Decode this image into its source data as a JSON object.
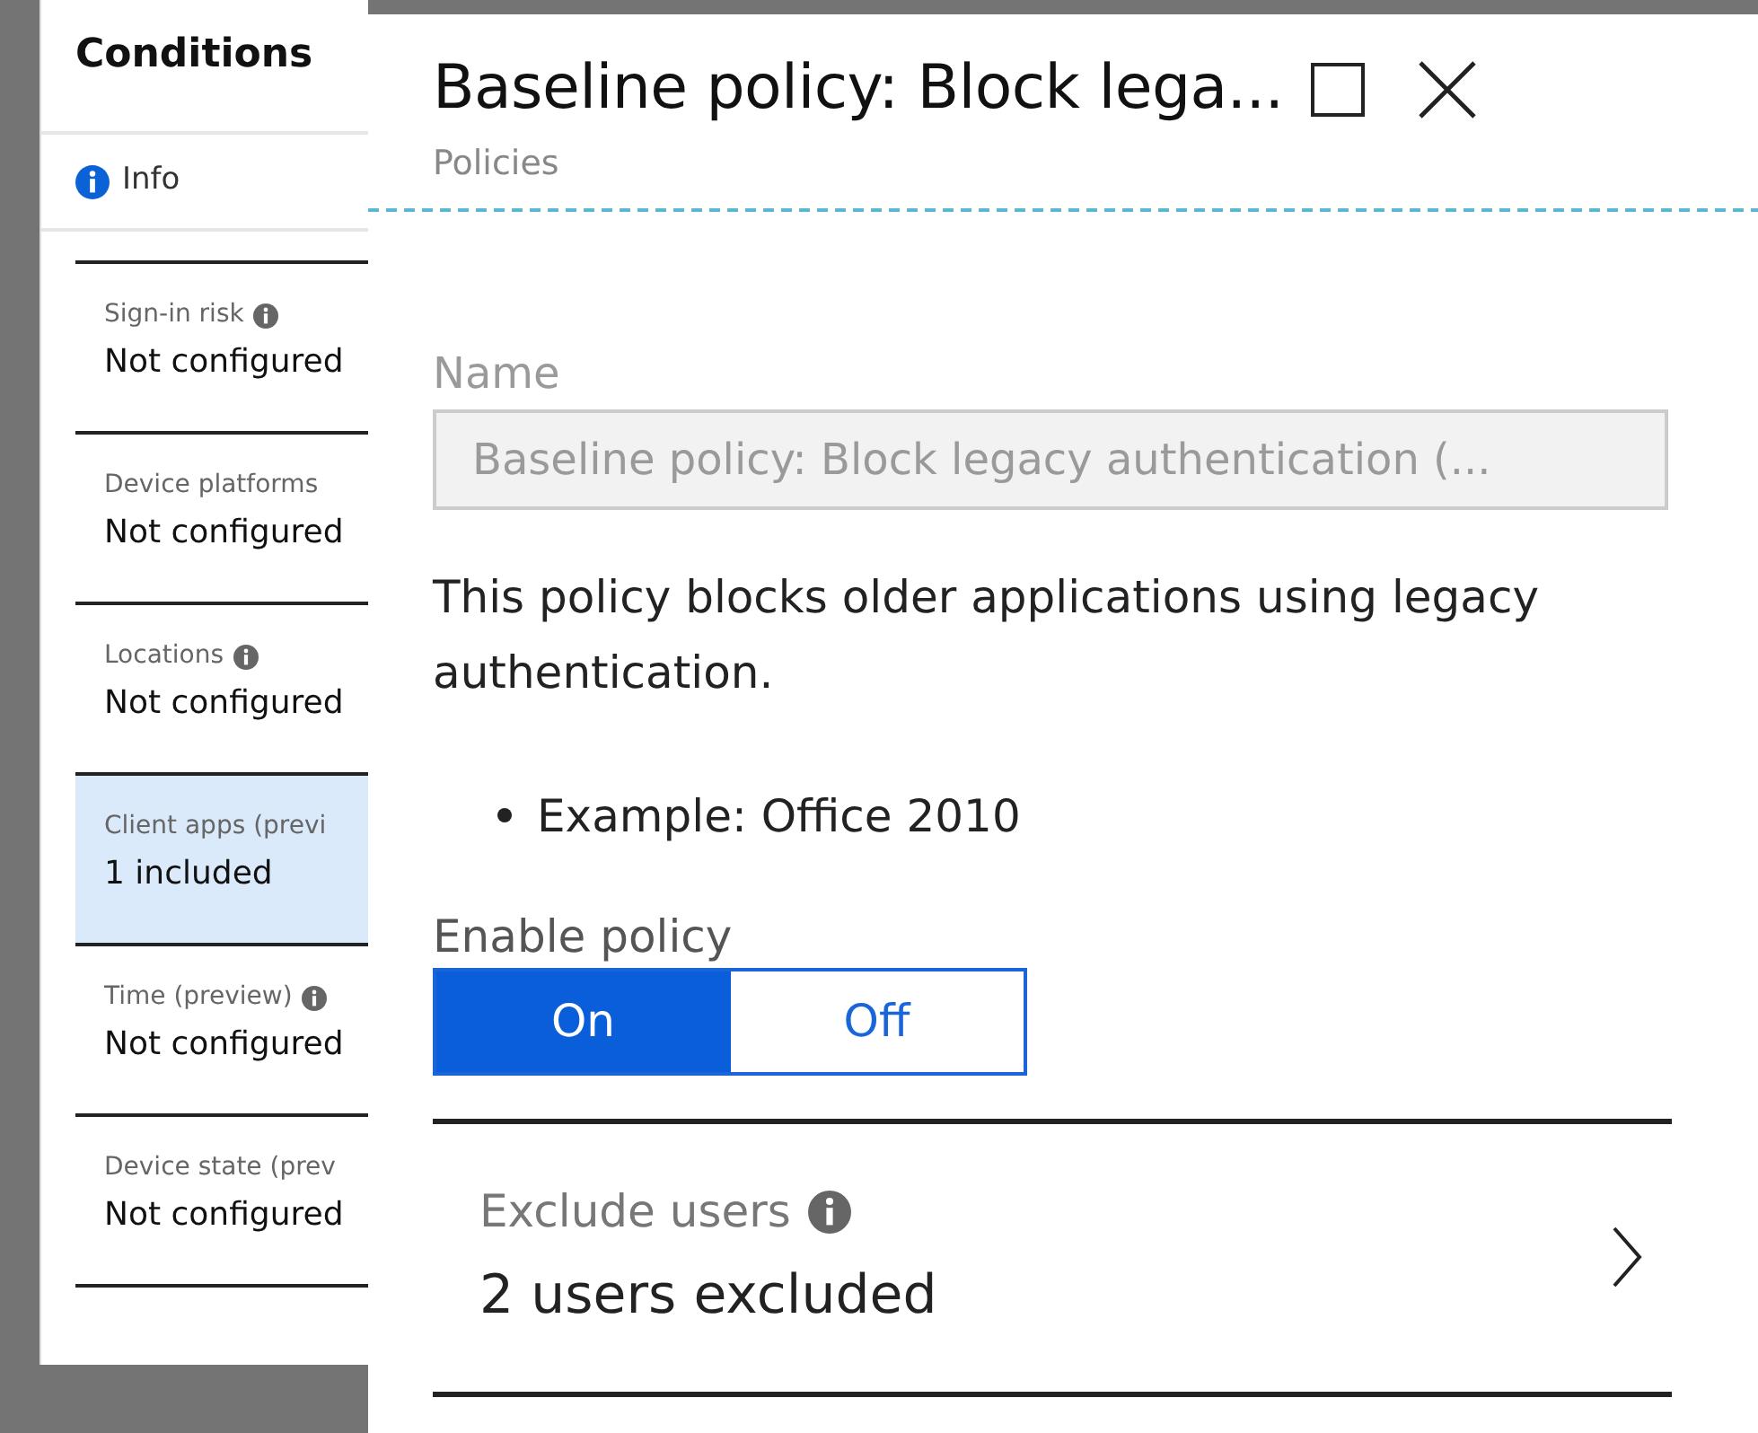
{
  "conditions_panel": {
    "title": "Conditions",
    "info_link": "Info",
    "items": [
      {
        "label": "Sign-in risk",
        "info": true,
        "value": "Not configured",
        "selected": false
      },
      {
        "label": "Device platforms",
        "info": false,
        "value": "Not configured",
        "selected": false
      },
      {
        "label": "Locations",
        "info": true,
        "value": "Not configured",
        "selected": false
      },
      {
        "label": "Client apps (previ",
        "info": false,
        "value": "1 included",
        "selected": true
      },
      {
        "label": "Time (preview)",
        "info": true,
        "value": "Not configured",
        "selected": false
      },
      {
        "label": "Device state (prev",
        "info": false,
        "value": "Not configured",
        "selected": false
      }
    ]
  },
  "policy_blade": {
    "title": "Baseline policy: Block lega...",
    "subtitle": "Policies",
    "name_field": {
      "label": "Name",
      "value": "Baseline policy: Block legacy authentication (...",
      "disabled": true
    },
    "description": "This policy blocks older applications using legacy authentication.",
    "bullets": [
      "Example: Office 2010"
    ],
    "enable_policy": {
      "label": "Enable policy",
      "options": [
        {
          "label": "On",
          "selected": true
        },
        {
          "label": "Off",
          "selected": false
        }
      ]
    },
    "exclude_users": {
      "label": "Exclude users",
      "info": true,
      "value": "2 users excluded"
    }
  }
}
